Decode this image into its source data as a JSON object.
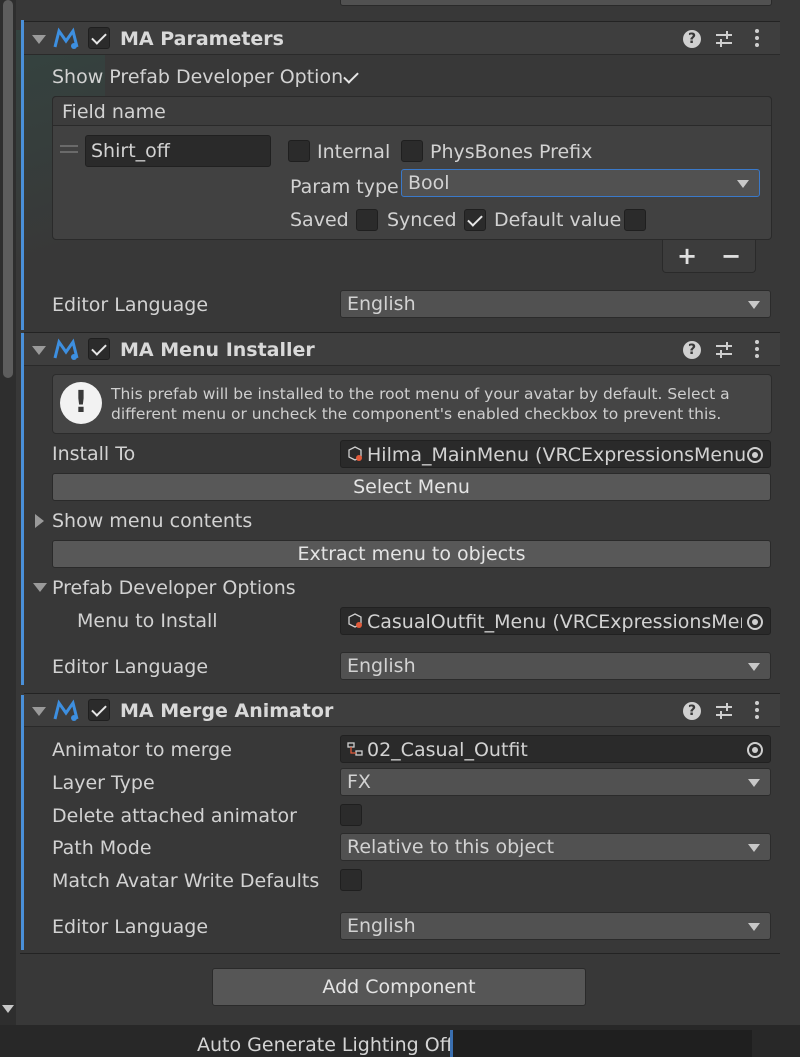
{
  "parameters": {
    "title": "MA Parameters",
    "show_prefab_label": "Show Prefab Developer Option",
    "field_name_header": "Field name",
    "entry_name": "Shirt_off",
    "internal_label": "Internal",
    "physbones_label": "PhysBones Prefix",
    "param_type_label": "Param type",
    "param_type_value": "Bool",
    "saved_label": "Saved",
    "synced_label": "Synced",
    "default_value_label": "Default value",
    "add_symbol": "+",
    "remove_symbol": "−",
    "editor_language_label": "Editor Language",
    "editor_language_value": "English"
  },
  "menu_installer": {
    "title": "MA Menu Installer",
    "info_line1": "This prefab will be installed to the root menu of your avatar by default. Select a",
    "info_line2": "different menu or uncheck the component's enabled checkbox to prevent this.",
    "install_to_label": "Install To",
    "install_to_value": "Hilma_MainMenu (VRCExpressionsMenu)",
    "select_menu_label": "Select Menu",
    "show_menu_contents_label": "Show menu contents",
    "extract_menu_label": "Extract menu to objects",
    "prefab_dev_options_label": "Prefab Developer Options",
    "menu_to_install_label": "Menu to Install",
    "menu_to_install_value": "CasualOutfit_Menu (VRCExpressionsMenu)",
    "editor_language_label": "Editor Language",
    "editor_language_value": "English"
  },
  "merge_animator": {
    "title": "MA Merge Animator",
    "animator_label": "Animator to merge",
    "animator_value": "02_Casual_Outfit",
    "layer_type_label": "Layer Type",
    "layer_type_value": "FX",
    "delete_attached_label": "Delete attached animator",
    "path_mode_label": "Path Mode",
    "path_mode_value": "Relative to this object",
    "match_write_defaults_label": "Match Avatar Write Defaults",
    "editor_language_label": "Editor Language",
    "editor_language_value": "English"
  },
  "add_component_label": "Add Component",
  "status_bar": {
    "lighting_label": "Auto Generate Lighting Off"
  },
  "icons": {
    "help": "?",
    "info": "!"
  },
  "colors": {
    "accent": "#4a90d9",
    "background": "#383838",
    "header": "#3e3e3e"
  }
}
